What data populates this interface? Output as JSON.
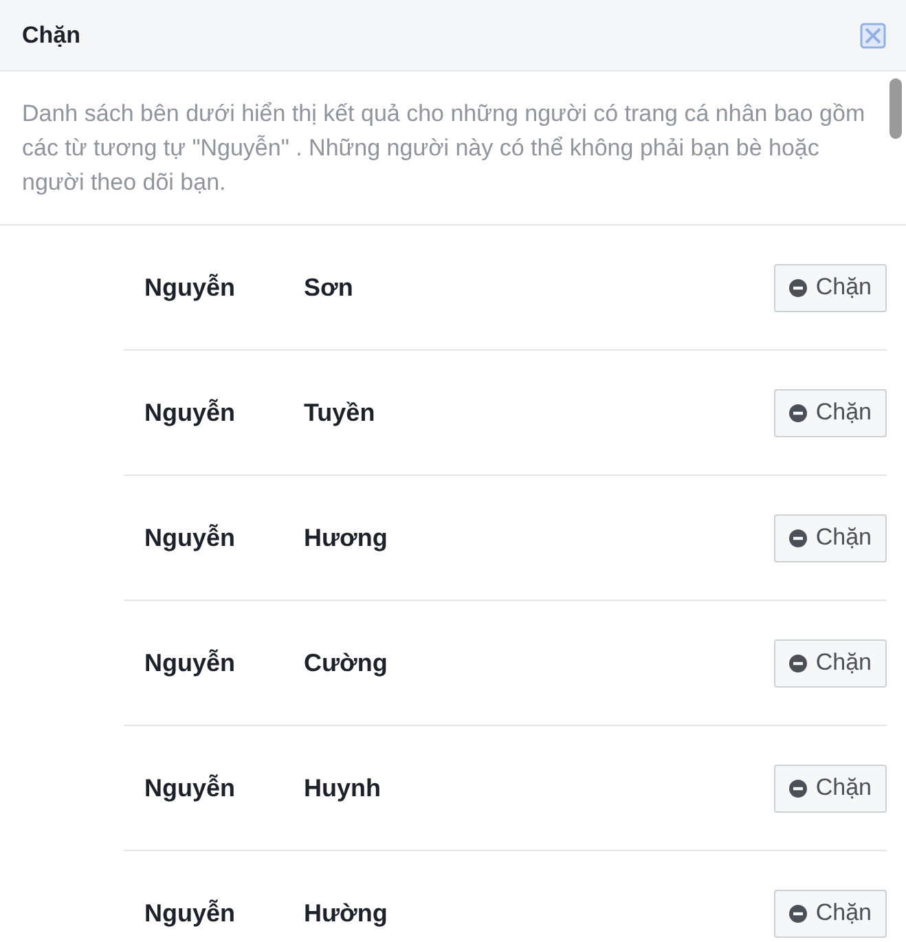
{
  "dialog": {
    "title": "Chặn"
  },
  "description": "Danh sách bên dưới hiển thị kết quả cho những người có trang cá nhân bao gồm các từ tương tự \"Nguyễn\" . Những người này có thể không phải bạn bè hoặc người theo dõi bạn.",
  "people": [
    {
      "family_name": "Nguyễn",
      "given_name": "Sơn",
      "button": "Chặn"
    },
    {
      "family_name": "Nguyễn",
      "given_name": "Tuyền",
      "button": "Chặn"
    },
    {
      "family_name": "Nguyễn",
      "given_name": "Hương",
      "button": "Chặn"
    },
    {
      "family_name": "Nguyễn",
      "given_name": "Cường",
      "button": "Chặn"
    },
    {
      "family_name": "Nguyễn",
      "given_name": "Huynh",
      "button": "Chặn"
    },
    {
      "family_name": "Nguyễn",
      "given_name": "Hường",
      "button": "Chặn"
    }
  ]
}
